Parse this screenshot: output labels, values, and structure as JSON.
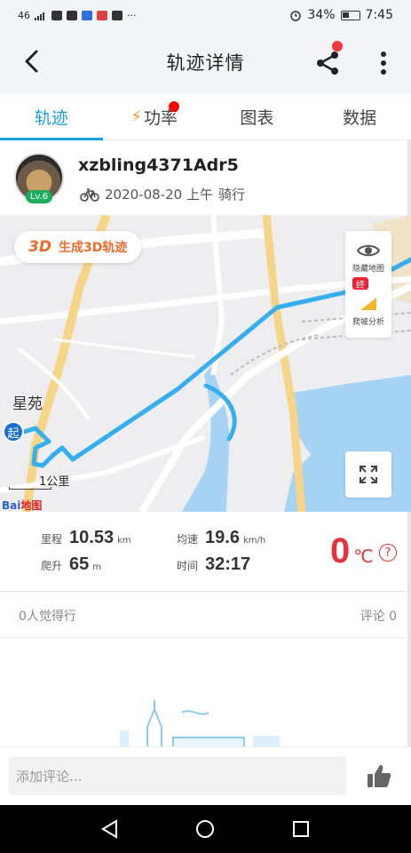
{
  "status_bar": {
    "signal_text": "46",
    "battery_percent": "34%",
    "time": "7:45"
  },
  "header": {
    "title": "轨迹详情"
  },
  "tabs": [
    {
      "label": "轨迹",
      "active": true
    },
    {
      "label": "功率",
      "active": false
    },
    {
      "label": "图表",
      "active": false
    },
    {
      "label": "数据",
      "active": false
    }
  ],
  "profile": {
    "username": "xzbling4371Adr5",
    "level": "Lv.6",
    "date_time": "2020-08-20 上午",
    "activity_type": "骑行"
  },
  "map": {
    "btn_3d_prefix": "3D",
    "btn_3d_label": "生成3D轨迹",
    "hide_map_label": "隐藏地图",
    "climb_analysis_label": "爬坡分析",
    "place_label": "星苑",
    "start_marker": "起",
    "end_marker": "终",
    "scale_label": "1公里",
    "provider_logo_a": "Bai",
    "provider_logo_b": "地图"
  },
  "stats": {
    "distance_label": "里程",
    "distance_value": "10.53",
    "distance_unit": "km",
    "avg_speed_label": "均速",
    "avg_speed_value": "19.6",
    "avg_speed_unit": "km/h",
    "climb_label": "爬升",
    "climb_value": "65",
    "climb_unit": "m",
    "time_label": "时间",
    "time_value": "32:17",
    "temperature_value": "0",
    "temperature_unit": "℃",
    "help_icon_glyph": "?"
  },
  "social": {
    "likes_text": "0人觉得行",
    "comments_text": "评论 0"
  },
  "comment_bar": {
    "placeholder": "添加评论..."
  },
  "colors": {
    "accent": "#1a9fe0",
    "route": "#35aef0",
    "temperature": "#e8323a",
    "orange": "#ef6b2d"
  }
}
